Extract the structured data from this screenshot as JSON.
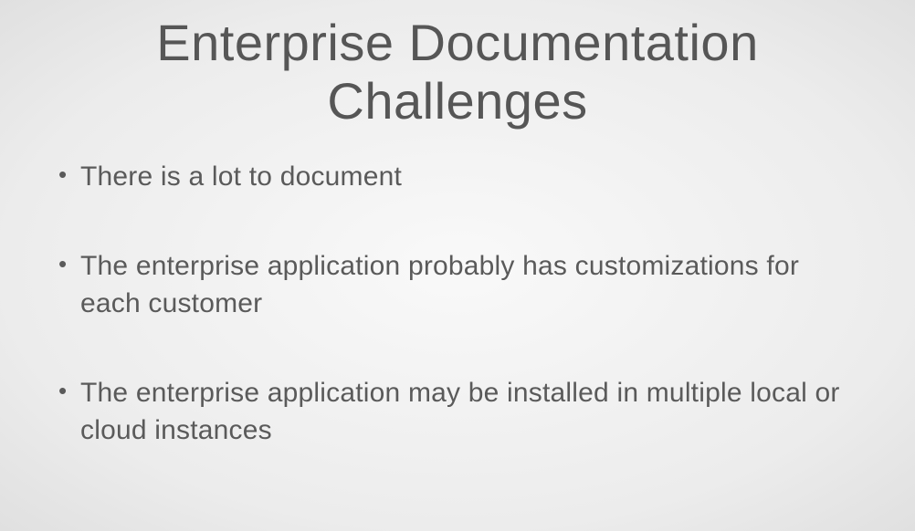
{
  "slide": {
    "title": "Enterprise Documentation Challenges",
    "bullets": [
      "There is a lot to document",
      "The enterprise application probably has customizations for each customer",
      "The enterprise application may be installed in multiple local or cloud instances"
    ]
  }
}
